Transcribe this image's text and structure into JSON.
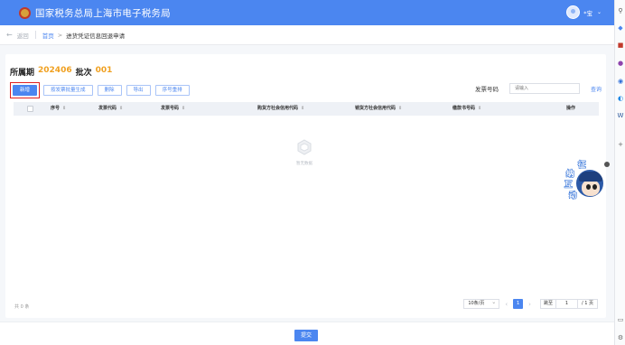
{
  "header": {
    "app_title": "国家税务总局上海市电子税务局",
    "user_name": "*宝",
    "user_caret": "⌄",
    "emblem_icon": "national-tax-emblem",
    "accent_color": "#4b86f0"
  },
  "breadcrumb": {
    "back_label": "返回",
    "back_icon": "←",
    "home": "首页",
    "separator": ">",
    "current": "进货凭证信息回退申请"
  },
  "period": {
    "label": "所属期",
    "value": "202406",
    "batch_label": "批次",
    "batch_value": "001",
    "highlight_color": "#f0a020"
  },
  "toolbar": {
    "add": "新增",
    "batch_generate": "按发票批量生成",
    "delete": "删除",
    "export": "导出",
    "reorder": "序号重排"
  },
  "filter": {
    "label": "发票号码",
    "placeholder": "请输入",
    "query": "查询"
  },
  "table": {
    "columns": [
      "序号",
      "发票代码",
      "发票号码",
      "购货方社会信用代码",
      "销货方社会信用代码",
      "缴款书号码",
      "操作"
    ],
    "sort_glyph": "⇕",
    "rows": [],
    "empty_text": "暂无数据"
  },
  "footer": {
    "total": "共 0 条",
    "page_size": "10条/页",
    "prev": "‹",
    "current_page": "1",
    "next": "›",
    "jump_label": "跳至",
    "jump_value": "1",
    "total_pages": "/ 1 页"
  },
  "actions": {
    "submit": "提交"
  },
  "assistant": {
    "chars": [
      "征",
      "纳",
      "互",
      "动"
    ]
  },
  "rail_icons": [
    "search-icon",
    "tag-icon",
    "briefcase-icon",
    "people-icon",
    "circle-icon",
    "outlook-icon",
    "word-icon",
    "plus-icon",
    "screen-icon",
    "settings-icon"
  ]
}
